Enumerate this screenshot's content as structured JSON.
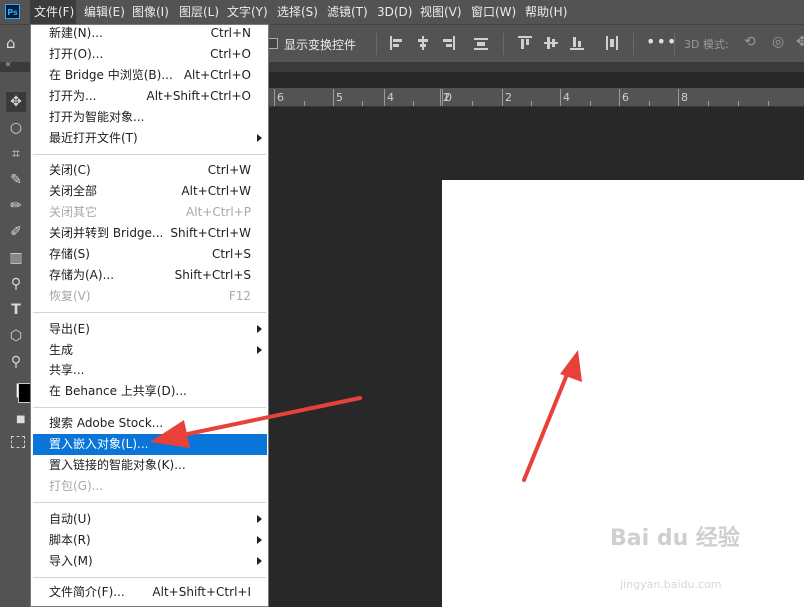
{
  "menubar": {
    "logo": "Ps",
    "items": [
      "文件(F)",
      "编辑(E)",
      "图像(I)",
      "图层(L)",
      "文字(Y)",
      "选择(S)",
      "滤镜(T)",
      "3D(D)",
      "视图(V)",
      "窗口(W)",
      "帮助(H)"
    ]
  },
  "options": {
    "show_transform": "显示变换控件",
    "more": "•••",
    "mode_3d": "3D 模式:"
  },
  "collapse": "«",
  "ruler": {
    "labels": [
      "6",
      "5",
      "4",
      "2",
      "0",
      "2",
      "4",
      "6",
      "8"
    ]
  },
  "file_menu": {
    "items": [
      {
        "label": "新建(N)...",
        "shortcut": "Ctrl+N"
      },
      {
        "label": "打开(O)...",
        "shortcut": "Ctrl+O"
      },
      {
        "label": "在 Bridge 中浏览(B)...",
        "shortcut": "Alt+Ctrl+O"
      },
      {
        "label": "打开为...",
        "shortcut": "Alt+Shift+Ctrl+O"
      },
      {
        "label": "打开为智能对象...",
        "shortcut": ""
      },
      {
        "label": "最近打开文件(T)",
        "shortcut": ""
      },
      {
        "label": "关闭(C)",
        "shortcut": "Ctrl+W"
      },
      {
        "label": "关闭全部",
        "shortcut": "Alt+Ctrl+W"
      },
      {
        "label": "关闭其它",
        "shortcut": "Alt+Ctrl+P"
      },
      {
        "label": "关闭并转到 Bridge...",
        "shortcut": "Shift+Ctrl+W"
      },
      {
        "label": "存储(S)",
        "shortcut": "Ctrl+S"
      },
      {
        "label": "存储为(A)...",
        "shortcut": "Shift+Ctrl+S"
      },
      {
        "label": "恢复(V)",
        "shortcut": "F12"
      },
      {
        "label": "导出(E)",
        "shortcut": ""
      },
      {
        "label": "生成",
        "shortcut": ""
      },
      {
        "label": "共享...",
        "shortcut": ""
      },
      {
        "label": "在 Behance 上共享(D)...",
        "shortcut": ""
      },
      {
        "label": "搜索 Adobe Stock...",
        "shortcut": ""
      },
      {
        "label": "置入嵌入对象(L)...",
        "shortcut": ""
      },
      {
        "label": "置入链接的智能对象(K)...",
        "shortcut": ""
      },
      {
        "label": "打包(G)...",
        "shortcut": ""
      },
      {
        "label": "自动(U)",
        "shortcut": ""
      },
      {
        "label": "脚本(R)",
        "shortcut": ""
      },
      {
        "label": "导入(M)",
        "shortcut": ""
      },
      {
        "label": "文件简介(F)...",
        "shortcut": "Alt+Shift+Ctrl+I"
      }
    ]
  },
  "watermark": {
    "logo": "Bai du 经验",
    "url": "jingyan.baidu.com"
  },
  "colors": {
    "highlight": "#0a75d8",
    "arrow": "#e8413a"
  }
}
